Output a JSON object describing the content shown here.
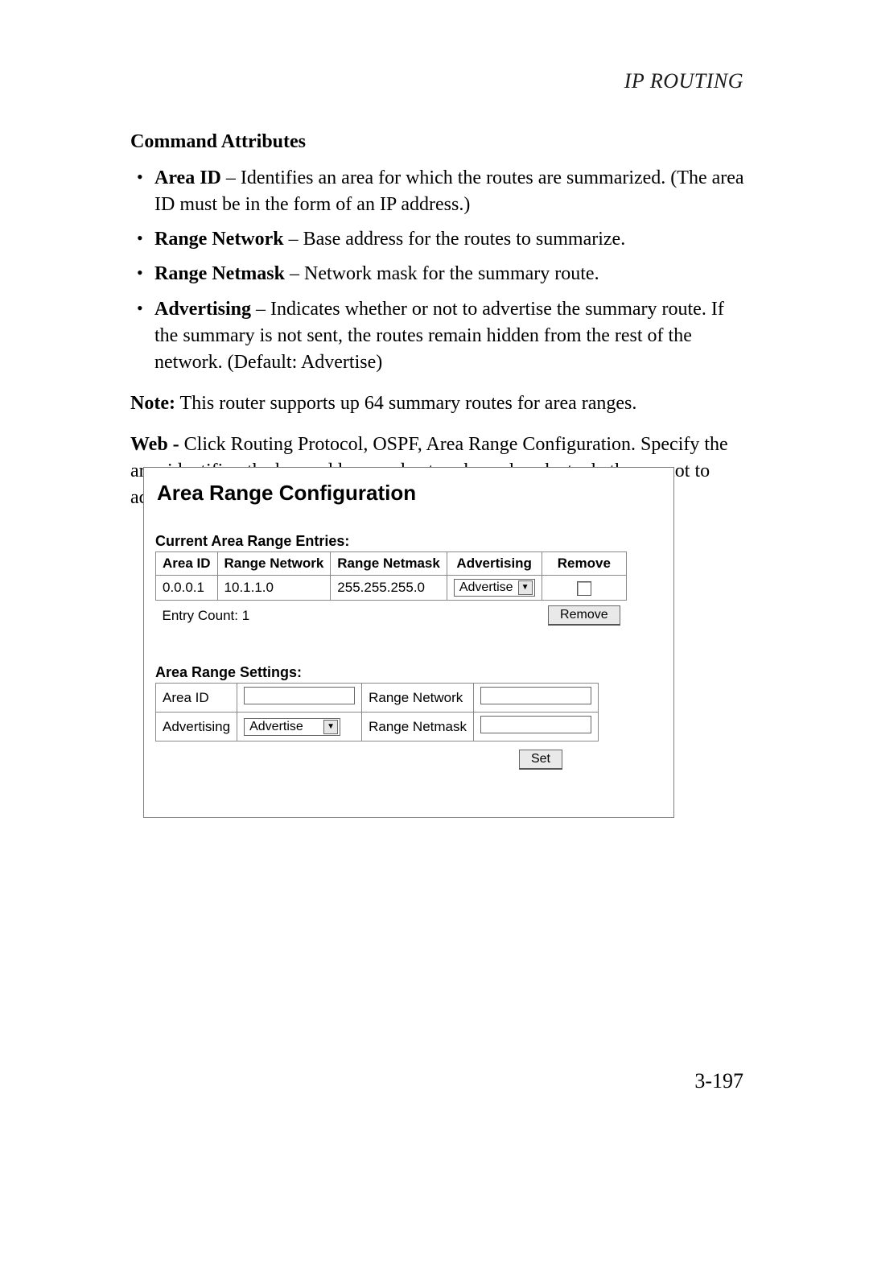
{
  "header": {
    "running_head": "IP ROUTING"
  },
  "section": {
    "title": "Command Attributes",
    "bullets": [
      {
        "term": "Area ID",
        "desc": " – Identifies an area for which the routes are summarized. (The area ID must be in the form of an IP address.)"
      },
      {
        "term": "Range Network",
        "desc": " – Base address for the routes to summarize."
      },
      {
        "term": "Range Netmask",
        "desc": " – Network mask for the summary route."
      },
      {
        "term": "Advertising",
        "desc": " – Indicates whether or not to advertise the summary route. If the summary is not sent, the routes remain hidden from the rest of the network. (Default: Advertise)"
      }
    ],
    "note_lead": "Note:",
    "note_text": "  This router supports up 64 summary routes for area ranges.",
    "web_lead": "Web -",
    "web_text": " Click Routing Protocol, OSPF, Area Range Configuration. Specify the area identifier, the base address and network mask, select whether or not to advertise the summary route to other areas, and then click Apply."
  },
  "panel": {
    "title": "Area Range Configuration",
    "entries_label": "Current Area Range Entries:",
    "headers": {
      "area_id": "Area ID",
      "range_network": "Range Network",
      "range_netmask": "Range Netmask",
      "advertising": "Advertising",
      "remove": "Remove"
    },
    "row": {
      "area_id": "0.0.0.1",
      "range_network": "10.1.1.0",
      "range_netmask": "255.255.255.0",
      "advertising": "Advertise"
    },
    "entry_count": "Entry Count: 1",
    "remove_btn": "Remove",
    "settings_label": "Area Range Settings:",
    "settings": {
      "area_id_label": "Area ID",
      "advertising_label": "Advertising",
      "advertising_value": "Advertise",
      "range_network_label": "Range Network",
      "range_netmask_label": "Range Netmask"
    },
    "set_btn": "Set"
  },
  "footer": {
    "page_number": "3-197"
  }
}
